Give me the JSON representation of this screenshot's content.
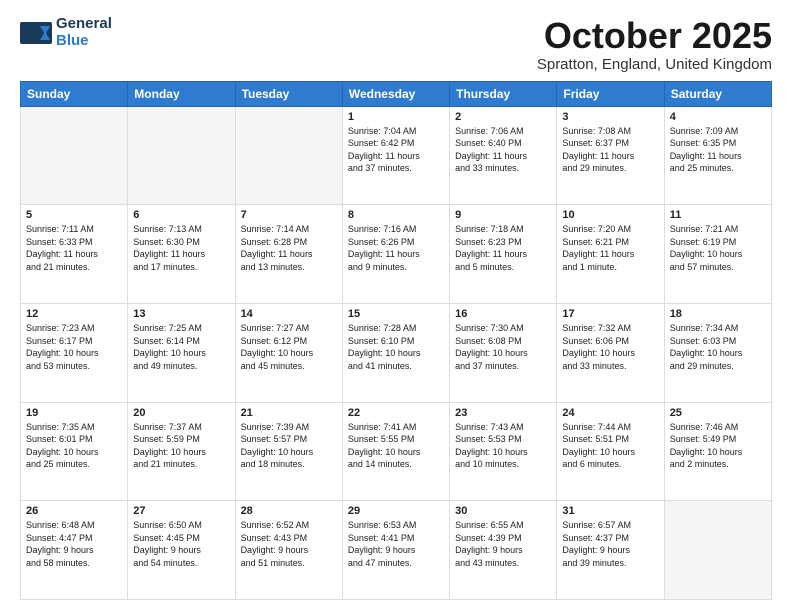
{
  "logo": {
    "line1": "General",
    "line2": "Blue"
  },
  "title": "October 2025",
  "location": "Spratton, England, United Kingdom",
  "days_header": [
    "Sunday",
    "Monday",
    "Tuesday",
    "Wednesday",
    "Thursday",
    "Friday",
    "Saturday"
  ],
  "weeks": [
    [
      {
        "day": "",
        "text": ""
      },
      {
        "day": "",
        "text": ""
      },
      {
        "day": "",
        "text": ""
      },
      {
        "day": "1",
        "text": "Sunrise: 7:04 AM\nSunset: 6:42 PM\nDaylight: 11 hours\nand 37 minutes."
      },
      {
        "day": "2",
        "text": "Sunrise: 7:06 AM\nSunset: 6:40 PM\nDaylight: 11 hours\nand 33 minutes."
      },
      {
        "day": "3",
        "text": "Sunrise: 7:08 AM\nSunset: 6:37 PM\nDaylight: 11 hours\nand 29 minutes."
      },
      {
        "day": "4",
        "text": "Sunrise: 7:09 AM\nSunset: 6:35 PM\nDaylight: 11 hours\nand 25 minutes."
      }
    ],
    [
      {
        "day": "5",
        "text": "Sunrise: 7:11 AM\nSunset: 6:33 PM\nDaylight: 11 hours\nand 21 minutes."
      },
      {
        "day": "6",
        "text": "Sunrise: 7:13 AM\nSunset: 6:30 PM\nDaylight: 11 hours\nand 17 minutes."
      },
      {
        "day": "7",
        "text": "Sunrise: 7:14 AM\nSunset: 6:28 PM\nDaylight: 11 hours\nand 13 minutes."
      },
      {
        "day": "8",
        "text": "Sunrise: 7:16 AM\nSunset: 6:26 PM\nDaylight: 11 hours\nand 9 minutes."
      },
      {
        "day": "9",
        "text": "Sunrise: 7:18 AM\nSunset: 6:23 PM\nDaylight: 11 hours\nand 5 minutes."
      },
      {
        "day": "10",
        "text": "Sunrise: 7:20 AM\nSunset: 6:21 PM\nDaylight: 11 hours\nand 1 minute."
      },
      {
        "day": "11",
        "text": "Sunrise: 7:21 AM\nSunset: 6:19 PM\nDaylight: 10 hours\nand 57 minutes."
      }
    ],
    [
      {
        "day": "12",
        "text": "Sunrise: 7:23 AM\nSunset: 6:17 PM\nDaylight: 10 hours\nand 53 minutes."
      },
      {
        "day": "13",
        "text": "Sunrise: 7:25 AM\nSunset: 6:14 PM\nDaylight: 10 hours\nand 49 minutes."
      },
      {
        "day": "14",
        "text": "Sunrise: 7:27 AM\nSunset: 6:12 PM\nDaylight: 10 hours\nand 45 minutes."
      },
      {
        "day": "15",
        "text": "Sunrise: 7:28 AM\nSunset: 6:10 PM\nDaylight: 10 hours\nand 41 minutes."
      },
      {
        "day": "16",
        "text": "Sunrise: 7:30 AM\nSunset: 6:08 PM\nDaylight: 10 hours\nand 37 minutes."
      },
      {
        "day": "17",
        "text": "Sunrise: 7:32 AM\nSunset: 6:06 PM\nDaylight: 10 hours\nand 33 minutes."
      },
      {
        "day": "18",
        "text": "Sunrise: 7:34 AM\nSunset: 6:03 PM\nDaylight: 10 hours\nand 29 minutes."
      }
    ],
    [
      {
        "day": "19",
        "text": "Sunrise: 7:35 AM\nSunset: 6:01 PM\nDaylight: 10 hours\nand 25 minutes."
      },
      {
        "day": "20",
        "text": "Sunrise: 7:37 AM\nSunset: 5:59 PM\nDaylight: 10 hours\nand 21 minutes."
      },
      {
        "day": "21",
        "text": "Sunrise: 7:39 AM\nSunset: 5:57 PM\nDaylight: 10 hours\nand 18 minutes."
      },
      {
        "day": "22",
        "text": "Sunrise: 7:41 AM\nSunset: 5:55 PM\nDaylight: 10 hours\nand 14 minutes."
      },
      {
        "day": "23",
        "text": "Sunrise: 7:43 AM\nSunset: 5:53 PM\nDaylight: 10 hours\nand 10 minutes."
      },
      {
        "day": "24",
        "text": "Sunrise: 7:44 AM\nSunset: 5:51 PM\nDaylight: 10 hours\nand 6 minutes."
      },
      {
        "day": "25",
        "text": "Sunrise: 7:46 AM\nSunset: 5:49 PM\nDaylight: 10 hours\nand 2 minutes."
      }
    ],
    [
      {
        "day": "26",
        "text": "Sunrise: 6:48 AM\nSunset: 4:47 PM\nDaylight: 9 hours\nand 58 minutes."
      },
      {
        "day": "27",
        "text": "Sunrise: 6:50 AM\nSunset: 4:45 PM\nDaylight: 9 hours\nand 54 minutes."
      },
      {
        "day": "28",
        "text": "Sunrise: 6:52 AM\nSunset: 4:43 PM\nDaylight: 9 hours\nand 51 minutes."
      },
      {
        "day": "29",
        "text": "Sunrise: 6:53 AM\nSunset: 4:41 PM\nDaylight: 9 hours\nand 47 minutes."
      },
      {
        "day": "30",
        "text": "Sunrise: 6:55 AM\nSunset: 4:39 PM\nDaylight: 9 hours\nand 43 minutes."
      },
      {
        "day": "31",
        "text": "Sunrise: 6:57 AM\nSunset: 4:37 PM\nDaylight: 9 hours\nand 39 minutes."
      },
      {
        "day": "",
        "text": ""
      }
    ]
  ]
}
